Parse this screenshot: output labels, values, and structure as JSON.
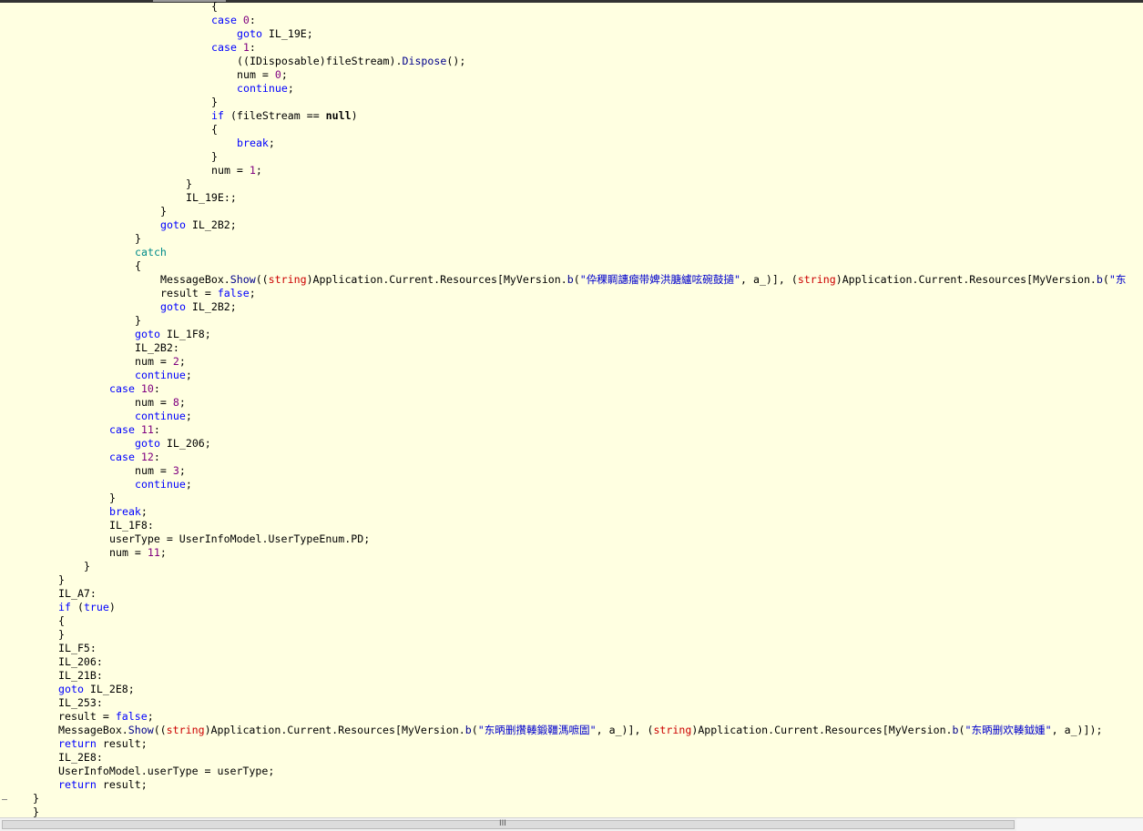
{
  "editor": {
    "lines": [
      {
        "indent": 232,
        "tokens": [
          {
            "t": "{"
          }
        ]
      },
      {
        "indent": 232,
        "tokens": [
          {
            "c": "kw",
            "t": "case "
          },
          {
            "c": "nu",
            "t": "0"
          },
          {
            "t": ":"
          }
        ]
      },
      {
        "indent": 260,
        "tokens": [
          {
            "c": "kw",
            "t": "goto"
          },
          {
            "t": " IL_19E;"
          }
        ]
      },
      {
        "indent": 232,
        "tokens": [
          {
            "c": "kw",
            "t": "case "
          },
          {
            "c": "nu",
            "t": "1"
          },
          {
            "t": ":"
          }
        ]
      },
      {
        "indent": 260,
        "tokens": [
          {
            "t": "((IDisposable)fileStream)."
          },
          {
            "c": "mb",
            "t": "Dispose"
          },
          {
            "t": "();"
          }
        ]
      },
      {
        "indent": 260,
        "tokens": [
          {
            "t": "num = "
          },
          {
            "c": "nu",
            "t": "0"
          },
          {
            "t": ";"
          }
        ]
      },
      {
        "indent": 260,
        "tokens": [
          {
            "c": "kw",
            "t": "continue"
          },
          {
            "t": ";"
          }
        ]
      },
      {
        "indent": 232,
        "tokens": [
          {
            "t": "}"
          }
        ]
      },
      {
        "indent": 232,
        "tokens": [
          {
            "c": "kw",
            "t": "if"
          },
          {
            "t": " (fileStream == "
          },
          {
            "c": "bo",
            "t": "null"
          },
          {
            "t": ")"
          }
        ]
      },
      {
        "indent": 232,
        "tokens": [
          {
            "t": "{"
          }
        ]
      },
      {
        "indent": 260,
        "tokens": [
          {
            "c": "kw",
            "t": "break"
          },
          {
            "t": ";"
          }
        ]
      },
      {
        "indent": 232,
        "tokens": [
          {
            "t": "}"
          }
        ]
      },
      {
        "indent": 232,
        "tokens": [
          {
            "t": "num = "
          },
          {
            "c": "nu",
            "t": "1"
          },
          {
            "t": ";"
          }
        ]
      },
      {
        "indent": 204,
        "tokens": [
          {
            "t": "}"
          }
        ]
      },
      {
        "indent": 204,
        "tokens": [
          {
            "t": "IL_19E:;"
          }
        ]
      },
      {
        "indent": 176,
        "tokens": [
          {
            "t": "}"
          }
        ]
      },
      {
        "indent": 176,
        "tokens": [
          {
            "c": "kw",
            "t": "goto"
          },
          {
            "t": " IL_2B2;"
          }
        ]
      },
      {
        "indent": 148,
        "tokens": [
          {
            "t": "}"
          }
        ]
      },
      {
        "indent": 148,
        "tokens": [
          {
            "c": "ct",
            "t": "catch"
          }
        ]
      },
      {
        "indent": 148,
        "tokens": [
          {
            "t": "{"
          }
        ]
      },
      {
        "indent": 176,
        "tokens": [
          {
            "t": "MessageBox."
          },
          {
            "c": "mb",
            "t": "Show"
          },
          {
            "t": "(("
          },
          {
            "c": "ty",
            "t": "string"
          },
          {
            "t": ")Application.Current.Resources[MyVersion."
          },
          {
            "c": "mb",
            "t": "b"
          },
          {
            "t": "("
          },
          {
            "c": "st",
            "t": "\"伜稞睭譓瘤带婢洪膅纑呟碗鼓擿\""
          },
          {
            "t": ", a_)], ("
          },
          {
            "c": "ty",
            "t": "string"
          },
          {
            "t": ")Application.Current.Resources[MyVersion."
          },
          {
            "c": "mb",
            "t": "b"
          },
          {
            "t": "("
          },
          {
            "c": "st",
            "t": "\"东"
          }
        ]
      },
      {
        "indent": 176,
        "tokens": [
          {
            "t": "result = "
          },
          {
            "c": "kw",
            "t": "false"
          },
          {
            "t": ";"
          }
        ]
      },
      {
        "indent": 176,
        "tokens": [
          {
            "c": "kw",
            "t": "goto"
          },
          {
            "t": " IL_2B2;"
          }
        ]
      },
      {
        "indent": 148,
        "tokens": [
          {
            "t": "}"
          }
        ]
      },
      {
        "indent": 148,
        "tokens": [
          {
            "c": "kw",
            "t": "goto"
          },
          {
            "t": " IL_1F8;"
          }
        ]
      },
      {
        "indent": 148,
        "tokens": [
          {
            "t": "IL_2B2:"
          }
        ]
      },
      {
        "indent": 148,
        "tokens": [
          {
            "t": "num = "
          },
          {
            "c": "nu",
            "t": "2"
          },
          {
            "t": ";"
          }
        ]
      },
      {
        "indent": 148,
        "tokens": [
          {
            "c": "kw",
            "t": "continue"
          },
          {
            "t": ";"
          }
        ]
      },
      {
        "indent": 120,
        "tokens": [
          {
            "c": "kw",
            "t": "case "
          },
          {
            "c": "nu",
            "t": "10"
          },
          {
            "t": ":"
          }
        ]
      },
      {
        "indent": 148,
        "tokens": [
          {
            "t": "num = "
          },
          {
            "c": "nu",
            "t": "8"
          },
          {
            "t": ";"
          }
        ]
      },
      {
        "indent": 148,
        "tokens": [
          {
            "c": "kw",
            "t": "continue"
          },
          {
            "t": ";"
          }
        ]
      },
      {
        "indent": 120,
        "tokens": [
          {
            "c": "kw",
            "t": "case "
          },
          {
            "c": "nu",
            "t": "11"
          },
          {
            "t": ":"
          }
        ]
      },
      {
        "indent": 148,
        "tokens": [
          {
            "c": "kw",
            "t": "goto"
          },
          {
            "t": " IL_206;"
          }
        ]
      },
      {
        "indent": 120,
        "tokens": [
          {
            "c": "kw",
            "t": "case "
          },
          {
            "c": "nu",
            "t": "12"
          },
          {
            "t": ":"
          }
        ]
      },
      {
        "indent": 148,
        "tokens": [
          {
            "t": "num = "
          },
          {
            "c": "nu",
            "t": "3"
          },
          {
            "t": ";"
          }
        ]
      },
      {
        "indent": 148,
        "tokens": [
          {
            "c": "kw",
            "t": "continue"
          },
          {
            "t": ";"
          }
        ]
      },
      {
        "indent": 120,
        "tokens": [
          {
            "t": "}"
          }
        ]
      },
      {
        "indent": 120,
        "tokens": [
          {
            "c": "kw",
            "t": "break"
          },
          {
            "t": ";"
          }
        ]
      },
      {
        "indent": 120,
        "tokens": [
          {
            "t": "IL_1F8:"
          }
        ]
      },
      {
        "indent": 120,
        "tokens": [
          {
            "t": "userType = UserInfoModel.UserTypeEnum.PD;"
          }
        ]
      },
      {
        "indent": 120,
        "tokens": [
          {
            "t": "num = "
          },
          {
            "c": "nu",
            "t": "11"
          },
          {
            "t": ";"
          }
        ]
      },
      {
        "indent": 92,
        "tokens": [
          {
            "t": "}"
          }
        ]
      },
      {
        "indent": 64,
        "tokens": [
          {
            "t": "}"
          }
        ]
      },
      {
        "indent": 64,
        "tokens": [
          {
            "t": "IL_A7:"
          }
        ]
      },
      {
        "indent": 64,
        "tokens": [
          {
            "c": "kw",
            "t": "if"
          },
          {
            "t": " ("
          },
          {
            "c": "kw",
            "t": "true"
          },
          {
            "t": ")"
          }
        ]
      },
      {
        "indent": 64,
        "tokens": [
          {
            "t": "{"
          }
        ]
      },
      {
        "indent": 64,
        "tokens": [
          {
            "t": "}"
          }
        ]
      },
      {
        "indent": 64,
        "tokens": [
          {
            "t": "IL_F5:"
          }
        ]
      },
      {
        "indent": 64,
        "tokens": [
          {
            "t": "IL_206:"
          }
        ]
      },
      {
        "indent": 64,
        "tokens": [
          {
            "t": "IL_21B:"
          }
        ]
      },
      {
        "indent": 64,
        "tokens": [
          {
            "c": "kw",
            "t": "goto"
          },
          {
            "t": " IL_2E8;"
          }
        ]
      },
      {
        "indent": 64,
        "tokens": [
          {
            "t": "IL_253:"
          }
        ]
      },
      {
        "indent": 64,
        "tokens": [
          {
            "t": "result = "
          },
          {
            "c": "kw",
            "t": "false"
          },
          {
            "t": ";"
          }
        ]
      },
      {
        "indent": 64,
        "tokens": [
          {
            "t": "MessageBox."
          },
          {
            "c": "mb",
            "t": "Show"
          },
          {
            "t": "(("
          },
          {
            "c": "ty",
            "t": "string"
          },
          {
            "t": ")Application.Current.Resources[MyVersion."
          },
          {
            "c": "mb",
            "t": "b"
          },
          {
            "t": "("
          },
          {
            "c": "st",
            "t": "\"东昞删攢輳鍛韁溤嗻圁\""
          },
          {
            "t": ", a_)], ("
          },
          {
            "c": "ty",
            "t": "string"
          },
          {
            "t": ")Application.Current.Resources[MyVersion."
          },
          {
            "c": "mb",
            "t": "b"
          },
          {
            "t": "("
          },
          {
            "c": "st",
            "t": "\"东昞删欢輳鉞媑\""
          },
          {
            "t": ", a_)]);"
          }
        ]
      },
      {
        "indent": 64,
        "tokens": [
          {
            "c": "kw",
            "t": "return"
          },
          {
            "t": " result;"
          }
        ]
      },
      {
        "indent": 64,
        "tokens": [
          {
            "t": "IL_2E8:"
          }
        ]
      },
      {
        "indent": 64,
        "tokens": [
          {
            "t": "UserInfoModel.userType = userType;"
          }
        ]
      },
      {
        "indent": 64,
        "tokens": [
          {
            "c": "kw",
            "t": "return"
          },
          {
            "t": " result;"
          }
        ]
      },
      {
        "indent": 36,
        "tokens": [
          {
            "t": "}"
          }
        ]
      },
      {
        "indent": 36,
        "tokens": [
          {
            "t": "}"
          }
        ]
      }
    ]
  },
  "scrollbar": {
    "grip_glyph": "III"
  }
}
